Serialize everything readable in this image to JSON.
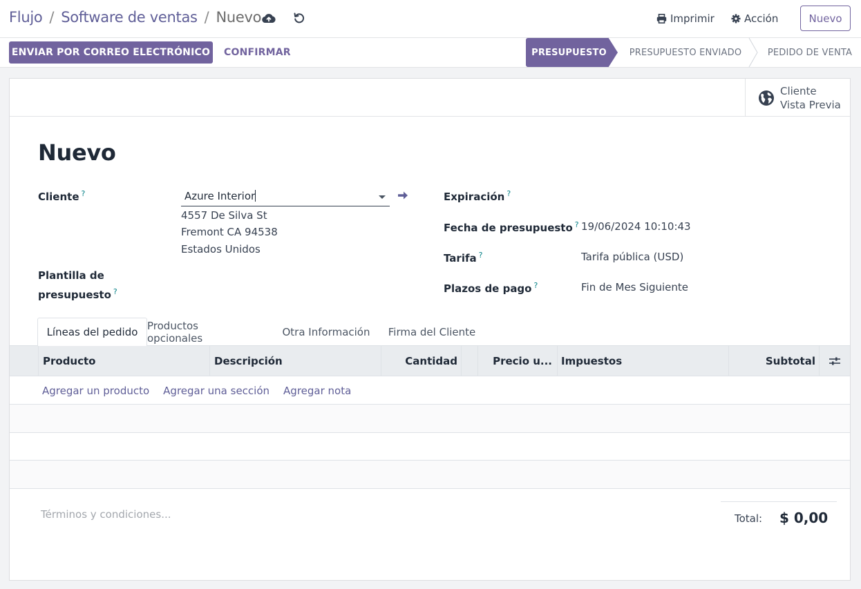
{
  "breadcrumb": {
    "items": [
      "Flujo",
      "Software de ventas"
    ],
    "current": "Nuevo",
    "separator": "/"
  },
  "topbar": {
    "print_label": "Imprimir",
    "action_label": "Acción",
    "new_label": "Nuevo"
  },
  "actionbar": {
    "send_email_label": "ENVIAR POR CORREO ELECTRÓNICO",
    "confirm_label": "CONFIRMAR",
    "statuses": [
      "PRESUPUESTO",
      "PRESUPUESTO ENVIADO",
      "PEDIDO DE VENTA"
    ],
    "active_status": "PRESUPUESTO"
  },
  "preview": {
    "line1": "Cliente",
    "line2": "Vista Previa"
  },
  "record": {
    "title": "Nuevo"
  },
  "form": {
    "client_label": "Cliente",
    "client_value": "Azure Interior",
    "client_address": [
      "4557 De Silva St",
      "Fremont CA 94538",
      "Estados Unidos"
    ],
    "template_label_line1": "Plantilla de",
    "template_label_line2": "presupuesto",
    "expiration_label": "Expiración",
    "quote_date_label": "Fecha de presupuesto",
    "quote_date_value": "19/06/2024 10:10:43",
    "pricelist_label": "Tarifa",
    "pricelist_value": "Tarifa pública (USD)",
    "payment_terms_label": "Plazos de pago",
    "payment_terms_value": "Fin de Mes Siguiente",
    "help_marker": "?"
  },
  "tabs": [
    "Líneas del pedido",
    "Productos opcionales",
    "Otra Información",
    "Firma del Cliente"
  ],
  "table": {
    "headers": [
      "Producto",
      "Descripción",
      "Cantidad",
      "Precio u...",
      "Impuestos",
      "Subtotal"
    ],
    "add_links": [
      "Agregar un producto",
      "Agregar una sección",
      "Agregar nota"
    ]
  },
  "footer": {
    "terms_placeholder": "Términos y condiciones...",
    "total_label": "Total:",
    "total_value": "$ 0,00"
  },
  "colors": {
    "brand": "#71639e",
    "link": "#5f5e97",
    "help": "#017e84"
  }
}
